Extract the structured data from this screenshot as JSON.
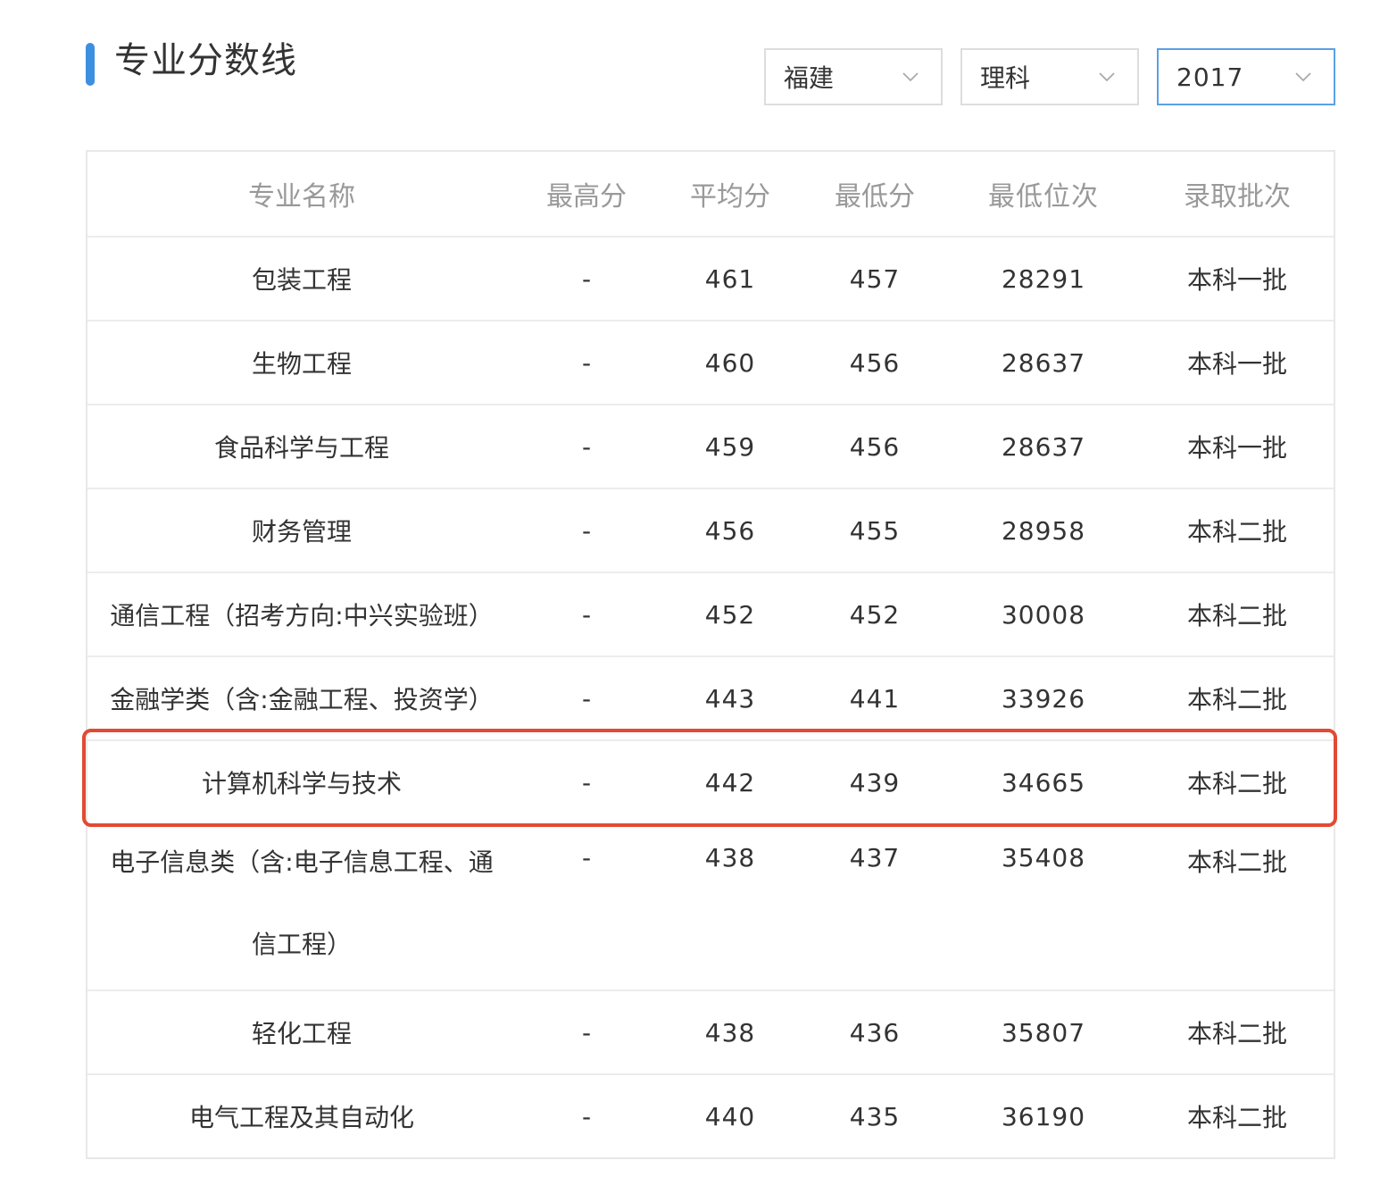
{
  "title": "专业分数线",
  "filters": {
    "province": "福建",
    "subject": "理科",
    "year": "2017"
  },
  "table": {
    "headers": [
      "专业名称",
      "最高分",
      "平均分",
      "最低分",
      "最低位次",
      "录取批次"
    ],
    "rows": [
      {
        "name": "包装工程",
        "max": "-",
        "avg": "461",
        "min": "457",
        "rank": "28291",
        "batch": "本科一批"
      },
      {
        "name": "生物工程",
        "max": "-",
        "avg": "460",
        "min": "456",
        "rank": "28637",
        "batch": "本科一批"
      },
      {
        "name": "食品科学与工程",
        "max": "-",
        "avg": "459",
        "min": "456",
        "rank": "28637",
        "batch": "本科一批"
      },
      {
        "name": "财务管理",
        "max": "-",
        "avg": "456",
        "min": "455",
        "rank": "28958",
        "batch": "本科二批"
      },
      {
        "name": "通信工程（招考方向:中兴实验班）",
        "max": "-",
        "avg": "452",
        "min": "452",
        "rank": "30008",
        "batch": "本科二批"
      },
      {
        "name": "金融学类（含:金融工程、投资学）",
        "max": "-",
        "avg": "443",
        "min": "441",
        "rank": "33926",
        "batch": "本科二批"
      },
      {
        "name": "计算机科学与技术",
        "max": "-",
        "avg": "442",
        "min": "439",
        "rank": "34665",
        "batch": "本科二批"
      },
      {
        "name": "电子信息类（含:电子信息工程、通信工程）",
        "max": "-",
        "avg": "438",
        "min": "437",
        "rank": "35408",
        "batch": "本科二批"
      },
      {
        "name": "轻化工程",
        "max": "-",
        "avg": "438",
        "min": "436",
        "rank": "35807",
        "batch": "本科二批"
      },
      {
        "name": "电气工程及其自动化",
        "max": "-",
        "avg": "440",
        "min": "435",
        "rank": "36190",
        "batch": "本科二批"
      }
    ]
  },
  "highlighted_row": 6,
  "colors": {
    "accent": "#3d8fe0",
    "highlight": "#e24a33",
    "header_text": "#999999",
    "active_border": "#5aa0e6"
  },
  "icons": {
    "select_arrow": "chevron-down-icon",
    "title_marker": "title-accent-bar"
  }
}
